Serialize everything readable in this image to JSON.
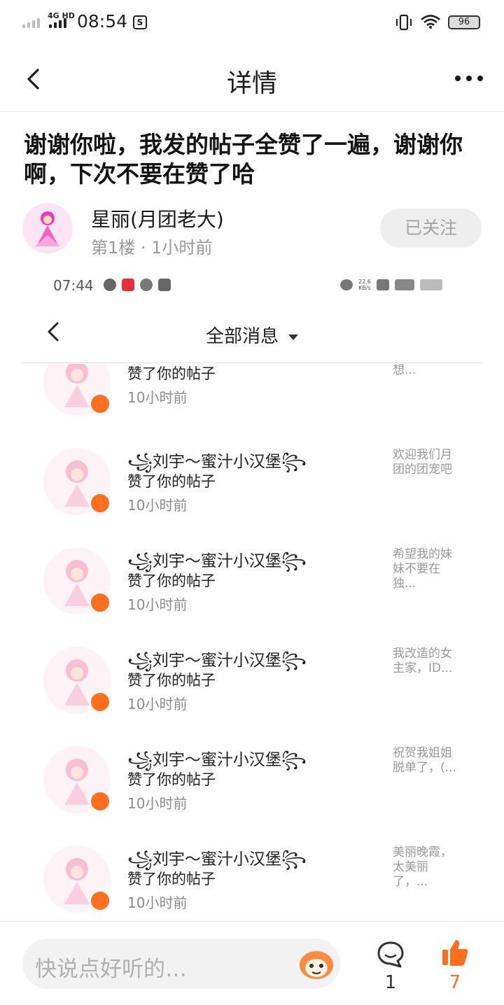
{
  "status_bar": {
    "network": "4G HD",
    "time": "08:54",
    "notification_icon": "s-notification-icon",
    "battery": "96"
  },
  "header": {
    "title": "详情",
    "back_icon": "chevron-left-icon",
    "more_icon": "more-dots-icon"
  },
  "post": {
    "title": "谢谢你啦，我发的帖子全赞了一遍，谢谢你啊，下次不要在赞了哈",
    "author": {
      "name": "星丽(月团老大)",
      "meta": "第1楼 · 1小时前"
    },
    "follow_label": "已关注"
  },
  "embedded_screenshot": {
    "status_time": "07:44",
    "speed": "22.6\nKB/s",
    "header_title": "全部消息",
    "messages": [
      {
        "name": "",
        "action": "赞了你的帖子",
        "time": "10小时前",
        "preview": "好友啊，想..."
      },
      {
        "name": "꧁刘宇～蜜汁小汉堡꧂",
        "action": "赞了你的帖子",
        "time": "10小时前",
        "preview": "欢迎我们月团的团宠吧"
      },
      {
        "name": "꧁刘宇～蜜汁小汉堡꧂",
        "action": "赞了你的帖子",
        "time": "10小时前",
        "preview": "希望我的妹妹不要在独..."
      },
      {
        "name": "꧁刘宇～蜜汁小汉堡꧂",
        "action": "赞了你的帖子",
        "time": "10小时前",
        "preview": "我改造的女主家，ID..."
      },
      {
        "name": "꧁刘宇～蜜汁小汉堡꧂",
        "action": "赞了你的帖子",
        "time": "10小时前",
        "preview": "祝贺我姐姐脱单了，(..."
      },
      {
        "name": "꧁刘宇～蜜汁小汉堡꧂",
        "action": "赞了你的帖子",
        "time": "10小时前",
        "preview": "美丽晚霞，太美丽了，..."
      }
    ]
  },
  "bottom_bar": {
    "comment_placeholder": "快说点好听的…",
    "comment_count": "1",
    "like_count": "7"
  },
  "colors": {
    "accent": "#ff6f1e",
    "muted_text": "#999999",
    "follow_bg": "#eeeeee"
  }
}
